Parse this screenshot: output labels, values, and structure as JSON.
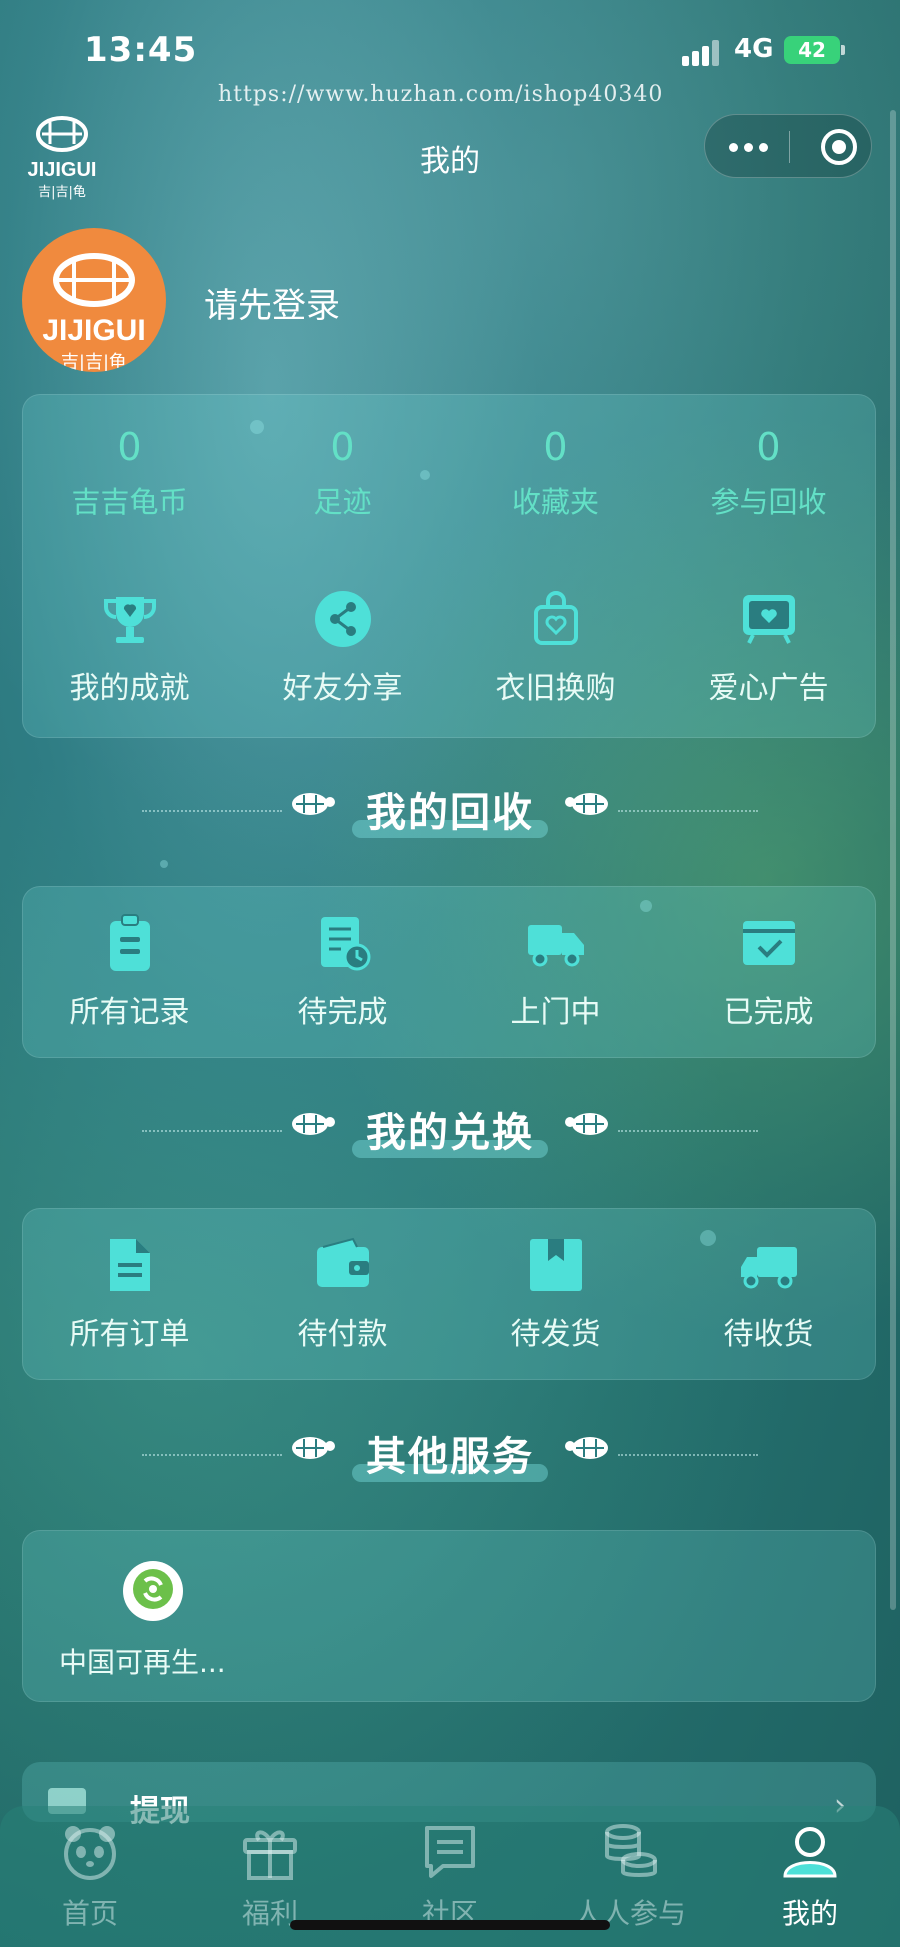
{
  "status_bar": {
    "time": "13:45",
    "network": "4G",
    "battery": "42"
  },
  "watermark": "https://www.huzhan.com/ishop40340",
  "nav": {
    "title": "我的",
    "logo_text": "JIJIGUI",
    "logo_sub": "吉|吉|龟"
  },
  "profile": {
    "login_prompt": "请先登录",
    "avatar_text": "JIJIGUI",
    "avatar_sub": "吉|吉|龟"
  },
  "stats": [
    {
      "value": "0",
      "label": "吉吉龟币"
    },
    {
      "value": "0",
      "label": "足迹"
    },
    {
      "value": "0",
      "label": "收藏夹"
    },
    {
      "value": "0",
      "label": "参与回收"
    }
  ],
  "shortcuts": [
    {
      "icon": "trophy-icon",
      "label": "我的成就"
    },
    {
      "icon": "share-icon",
      "label": "好友分享"
    },
    {
      "icon": "shopping-bag-icon",
      "label": "衣旧换购"
    },
    {
      "icon": "tv-heart-icon",
      "label": "爱心广告"
    }
  ],
  "recycle": {
    "title": "我的回收",
    "items": [
      {
        "icon": "clipboard-icon",
        "label": "所有记录"
      },
      {
        "icon": "pending-doc-icon",
        "label": "待完成"
      },
      {
        "icon": "truck-icon",
        "label": "上门中"
      },
      {
        "icon": "done-box-icon",
        "label": "已完成"
      }
    ]
  },
  "exchange": {
    "title": "我的兑换",
    "items": [
      {
        "icon": "document-icon",
        "label": "所有订单"
      },
      {
        "icon": "wallet-icon",
        "label": "待付款"
      },
      {
        "icon": "package-icon",
        "label": "待发货"
      },
      {
        "icon": "delivery-truck-icon",
        "label": "待收货"
      }
    ]
  },
  "services": {
    "title": "其他服务",
    "items": [
      {
        "icon": "renewable-logo-icon",
        "label": "中国可再生..."
      }
    ]
  },
  "peek": {
    "label": "提现",
    "arrow": "›"
  },
  "tabs": [
    {
      "icon": "panda-icon",
      "label": "首页",
      "active": false
    },
    {
      "icon": "gift-icon",
      "label": "福利",
      "active": false
    },
    {
      "icon": "chat-icon",
      "label": "社区",
      "active": false
    },
    {
      "icon": "coins-icon",
      "label": "人人参与",
      "active": false
    },
    {
      "icon": "user-icon",
      "label": "我的",
      "active": true
    }
  ],
  "colors": {
    "accent": "#63e0c6",
    "icon": "#4ee0d8",
    "avatar_bg": "#f08a3e",
    "battery": "#38d27a"
  }
}
